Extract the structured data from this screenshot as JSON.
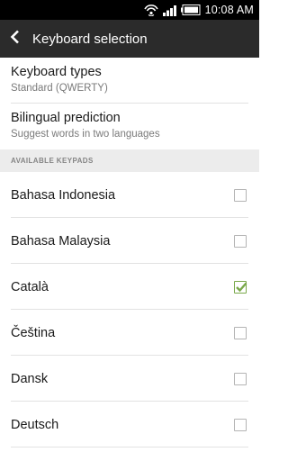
{
  "status_bar": {
    "time": "10:08 AM",
    "icons": [
      "sync-icon",
      "signal-icon",
      "battery-icon"
    ]
  },
  "action_bar": {
    "back_icon": "back-chevron-icon",
    "title": "Keyboard selection"
  },
  "preferences": [
    {
      "title": "Keyboard types",
      "summary": "Standard (QWERTY)"
    },
    {
      "title": "Bilingual prediction",
      "summary": "Suggest words in two languages"
    }
  ],
  "section": {
    "header": "AVAILABLE KEYPADS"
  },
  "keypads": [
    {
      "label": "Bahasa Indonesia",
      "checked": false
    },
    {
      "label": "Bahasa Malaysia",
      "checked": false
    },
    {
      "label": "Català",
      "checked": true
    },
    {
      "label": "Čeština",
      "checked": false
    },
    {
      "label": "Dansk",
      "checked": false
    },
    {
      "label": "Deutsch",
      "checked": false
    }
  ],
  "colors": {
    "action_bar": "#2b2b2b",
    "check_accent": "#7aa84a",
    "section_header_bg": "#ececec"
  }
}
